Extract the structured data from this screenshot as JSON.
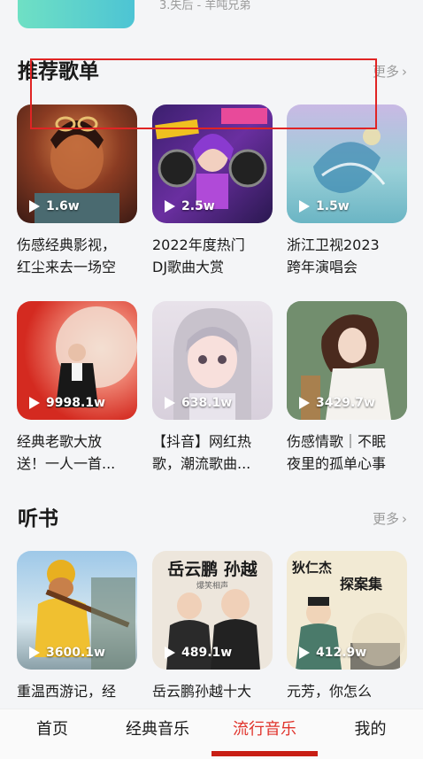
{
  "top_item": {
    "text": "3.失后 - 羊吨兄弟"
  },
  "sections": [
    {
      "title": "推荐歌单",
      "more_label": "更多",
      "cards": [
        {
          "title_line1": "伤感经典影视，",
          "title_line2": "红尘来去一场空",
          "play_count": "1.6w"
        },
        {
          "title_line1": "2022年度热门",
          "title_line2": "DJ歌曲大赏",
          "play_count": "2.5w"
        },
        {
          "title_line1": "浙江卫视2023",
          "title_line2": "跨年演唱会",
          "play_count": "1.5w"
        },
        {
          "title_line1": "经典老歌大放",
          "title_line2": "送！一人一首...",
          "play_count": "9998.1w"
        },
        {
          "title_line1": "【抖音】网红热",
          "title_line2": "歌，潮流歌曲...",
          "play_count": "638.1w"
        },
        {
          "title_line1": "伤感情歌｜不眠",
          "title_line2": "夜里的孤单心事",
          "play_count": "3429.7w"
        }
      ]
    },
    {
      "title": "听书",
      "more_label": "更多",
      "cards": [
        {
          "title_line1": "重温西游记，经",
          "play_count": "3600.1w"
        },
        {
          "title_line1": "岳云鹏孙越十大",
          "play_count": "489.1w",
          "cover_text": "岳云鹏 孙越",
          "cover_sub": "爆笑相声"
        },
        {
          "title_line1": "元芳，你怎么",
          "play_count": "412.9w",
          "cover_text": "狄仁杰",
          "cover_sub": "探案集"
        }
      ]
    }
  ],
  "tabs": [
    {
      "label": "首页",
      "active": false
    },
    {
      "label": "经典音乐",
      "active": false
    },
    {
      "label": "流行音乐",
      "active": true
    },
    {
      "label": "我的",
      "active": false
    }
  ],
  "colors": {
    "accent": "#e0342c",
    "highlight_box": "#e02424",
    "muted": "#9a9a9a"
  }
}
